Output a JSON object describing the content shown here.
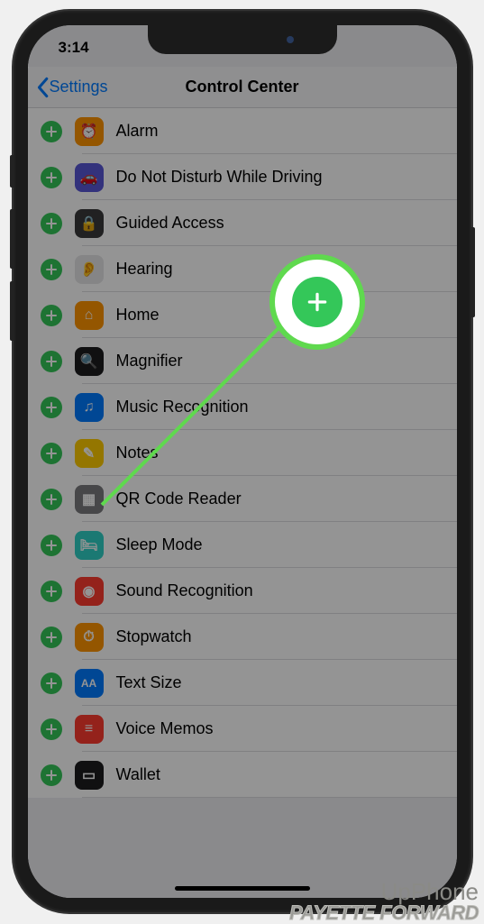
{
  "status": {
    "time": "3:14"
  },
  "nav": {
    "back": "Settings",
    "title": "Control Center"
  },
  "rows": [
    {
      "name": "alarm",
      "label": "Alarm",
      "iconClass": "ic-alarm",
      "glyph": "⏰"
    },
    {
      "name": "dnd-driving",
      "label": "Do Not Disturb While Driving",
      "iconClass": "ic-dnd",
      "glyph": "🚗"
    },
    {
      "name": "guided-access",
      "label": "Guided Access",
      "iconClass": "ic-guided",
      "glyph": "🔒"
    },
    {
      "name": "hearing",
      "label": "Hearing",
      "iconClass": "ic-hearing",
      "glyph": "👂"
    },
    {
      "name": "home",
      "label": "Home",
      "iconClass": "ic-home",
      "glyph": "⌂"
    },
    {
      "name": "magnifier",
      "label": "Magnifier",
      "iconClass": "ic-magnifier",
      "glyph": "🔍"
    },
    {
      "name": "music-recognition",
      "label": "Music Recognition",
      "iconClass": "ic-music",
      "glyph": "♫"
    },
    {
      "name": "notes",
      "label": "Notes",
      "iconClass": "ic-notes",
      "glyph": "✎"
    },
    {
      "name": "qr-code-reader",
      "label": "QR Code Reader",
      "iconClass": "ic-qr",
      "glyph": "▦",
      "highlighted": true
    },
    {
      "name": "sleep-mode",
      "label": "Sleep Mode",
      "iconClass": "ic-sleep",
      "glyph": "🛏"
    },
    {
      "name": "sound-recognition",
      "label": "Sound Recognition",
      "iconClass": "ic-sound",
      "glyph": "◉"
    },
    {
      "name": "stopwatch",
      "label": "Stopwatch",
      "iconClass": "ic-stopwatch",
      "glyph": "⏱"
    },
    {
      "name": "text-size",
      "label": "Text Size",
      "iconClass": "ic-text",
      "glyph": "AA"
    },
    {
      "name": "voice-memos",
      "label": "Voice Memos",
      "iconClass": "ic-voice",
      "glyph": "≡"
    },
    {
      "name": "wallet",
      "label": "Wallet",
      "iconClass": "ic-wallet",
      "glyph": "▭"
    }
  ],
  "watermark": {
    "line1": "UpPhone",
    "line2": "PAYETTE FORWARD"
  }
}
